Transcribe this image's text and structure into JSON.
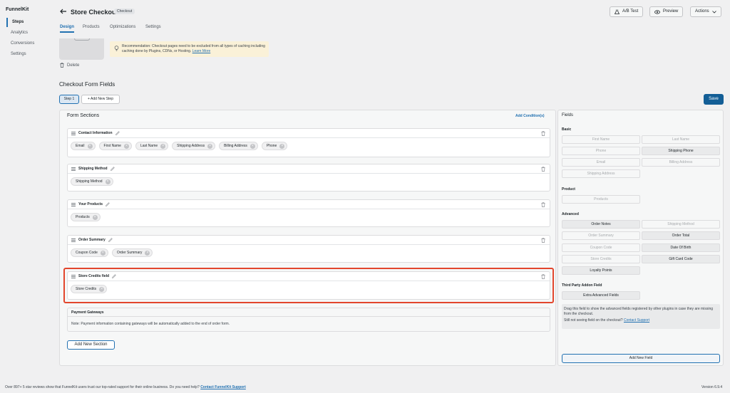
{
  "sidebar": {
    "brand": "FunnelKit",
    "items": [
      {
        "label": "Steps",
        "active": true
      },
      {
        "label": "Analytics",
        "active": false
      },
      {
        "label": "Conversions",
        "active": false
      },
      {
        "label": "Settings",
        "active": false
      }
    ]
  },
  "header": {
    "title": "Store Checkout",
    "badge": "Checkout",
    "ab_test": "A/B Test",
    "preview": "Preview",
    "actions": "Actions",
    "tabs": [
      "Design",
      "Products",
      "Optimizations",
      "Settings"
    ],
    "active_tab": "Design"
  },
  "template": {
    "delete_label": "Delete",
    "notice_text": "Recommendation: Checkout pages need to be excluded from all types of caching including caching done by Plugins, CDNs, or Hosting. ",
    "notice_link": "Learn More"
  },
  "form": {
    "title": "Checkout Form Fields",
    "step_label": "Step 1",
    "add_step": "+ Add New Step",
    "save": "Save",
    "sections_title": "Form Sections",
    "add_condition": "Add Condition(s)",
    "sections": [
      {
        "title": "Contact Information",
        "chips": [
          "Email",
          "First Name",
          "Last Name",
          "Shipping Address",
          "Billing Address",
          "Phone"
        ]
      },
      {
        "title": "Shipping Method",
        "chips": [
          "Shipping Method"
        ]
      },
      {
        "title": "Your Products",
        "chips": [
          "Products"
        ]
      },
      {
        "title": "Order Summary",
        "chips": [
          "Coupon Code",
          "Order Summary"
        ]
      },
      {
        "title": "Store Credits field",
        "chips": [
          "Store Credits"
        ]
      }
    ],
    "payment_title": "Payment Gateways",
    "payment_note": "Note: Payment information containing gateways will be automatically added to the end of order form.",
    "add_section": "Add New Section"
  },
  "fields": {
    "title": "Fields",
    "groups": {
      "basic": "Basic",
      "product": "Product",
      "advanced": "Advanced",
      "third_party": "Third Party Addon Field"
    },
    "basic": [
      {
        "label": "First Name",
        "enabled": false
      },
      {
        "label": "Last Name",
        "enabled": false
      },
      {
        "label": "Phone",
        "enabled": false
      },
      {
        "label": "Shipping Phone",
        "enabled": true
      },
      {
        "label": "Email",
        "enabled": false
      },
      {
        "label": "Billing Address",
        "enabled": false
      },
      {
        "label": "Shipping Address",
        "enabled": false
      }
    ],
    "product": [
      {
        "label": "Products",
        "enabled": false
      }
    ],
    "advanced": [
      {
        "label": "Order Notes",
        "enabled": true
      },
      {
        "label": "Shipping Method",
        "enabled": false
      },
      {
        "label": "Order Summary",
        "enabled": false
      },
      {
        "label": "Order Total",
        "enabled": true
      },
      {
        "label": "Coupon Code",
        "enabled": false
      },
      {
        "label": "Date Of Birth",
        "enabled": true
      },
      {
        "label": "Store Credits",
        "enabled": false
      },
      {
        "label": "Gift Card Code",
        "enabled": true
      },
      {
        "label": "Loyalty Points",
        "enabled": true
      }
    ],
    "third_party": [
      {
        "label": "Extra Advanced Fields",
        "enabled": true
      }
    ],
    "drag_note": "Drag this field to show the advanced fields registered by other plugins in case they are missing from the checkout.",
    "support_prompt": "Still not seeing field on the checkout? ",
    "support_link": "Contact Support",
    "add_field": "Add New Field"
  },
  "footer": {
    "text": "Over 897+ 5 star reviews show that FunnelKit users trust our top-rated support for their online business. Do you need help? ",
    "link": "Contact FunnelKit Support",
    "version": "Version 6.9.4"
  },
  "colors": {
    "accent": "#2271b1",
    "save": "#135e96",
    "highlight": "#e2462d",
    "notice": "#faf1d8"
  }
}
